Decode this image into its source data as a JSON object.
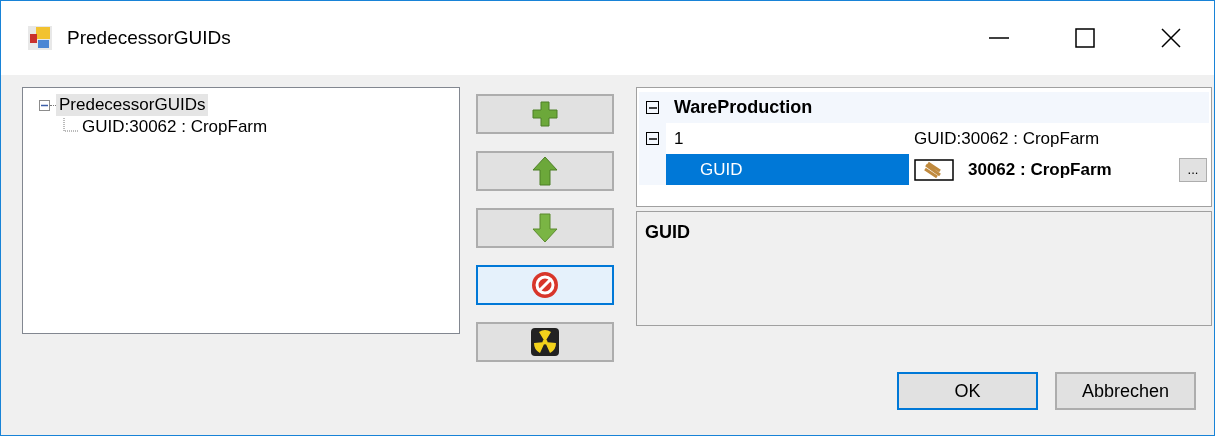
{
  "window": {
    "title": "PredecessorGUIDs"
  },
  "tree": {
    "label": "PredecessorGUIDs",
    "expanded": true,
    "selected": true,
    "children": [
      {
        "label": "GUID:30062 : CropFarm",
        "selected": false
      }
    ]
  },
  "tool_buttons": [
    {
      "kind": "add",
      "focused": false
    },
    {
      "kind": "up",
      "focused": false
    },
    {
      "kind": "down",
      "focused": false
    },
    {
      "kind": "remove",
      "focused": true
    },
    {
      "kind": "clear",
      "focused": false
    }
  ],
  "property_grid": {
    "category": {
      "label": "WareProduction",
      "expanded": true
    },
    "rows": [
      {
        "label": "1",
        "value": "GUID:30062 : CropFarm",
        "expanded": true,
        "selected": false,
        "children": [
          {
            "label": "GUID",
            "value": "30062 : CropFarm",
            "selected": true,
            "modified": true,
            "browse": "..."
          }
        ]
      }
    ]
  },
  "description": {
    "title": "GUID"
  },
  "buttons": [
    {
      "label": "OK",
      "default": true
    },
    {
      "label": "Abbrechen",
      "default": false
    }
  ]
}
